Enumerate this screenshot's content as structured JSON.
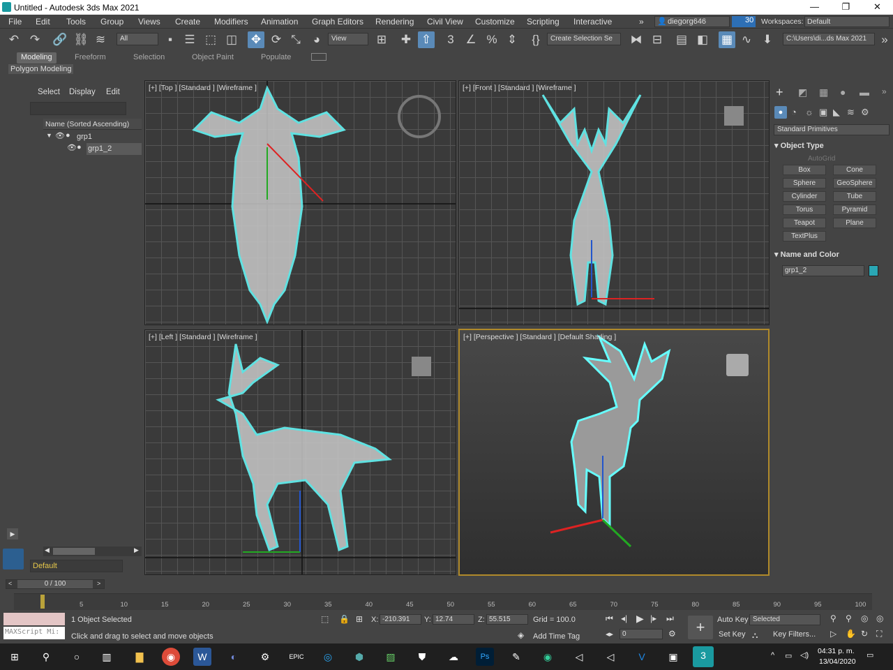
{
  "window": {
    "title": "Untitled - Autodesk 3ds Max 2021",
    "min": "—",
    "max": "❐",
    "close": "✕"
  },
  "menus": [
    "File",
    "Edit",
    "Tools",
    "Group",
    "Views",
    "Create",
    "Modifiers",
    "Animation",
    "Graph Editors",
    "Rendering",
    "Civil View",
    "Customize",
    "Scripting",
    "Interactive"
  ],
  "user": {
    "name": "diegorg646",
    "badge": "30",
    "workspaces_label": "Workspaces:",
    "workspace": "Default"
  },
  "toolbar": {
    "filter": "All",
    "view": "View",
    "selection_set": "Create Selection Se",
    "path": "C:\\Users\\di...ds Max 2021"
  },
  "ribbon": {
    "tabs": [
      "Modeling",
      "Freeform",
      "Selection",
      "Object Paint",
      "Populate"
    ],
    "sub": "Polygon Modeling"
  },
  "scene": {
    "tabs": [
      "Select",
      "Display",
      "Edit"
    ],
    "column": "Name (Sorted Ascending)",
    "items": [
      "grp1",
      "grp1_2"
    ],
    "layer": "Default"
  },
  "viewports": {
    "top": "[+] [Top ] [Standard ] [Wireframe ]",
    "front": "[+] [Front ] [Standard ] [Wireframe ]",
    "left": "[+] [Left ] [Standard ] [Wireframe ]",
    "persp": "[+] [Perspective ] [Standard ] [Default Shading ]"
  },
  "right": {
    "category": "Standard Primitives",
    "object_type": "Object Type",
    "autogrid": "AutoGrid",
    "buttons": [
      "Box",
      "Cone",
      "Sphere",
      "GeoSphere",
      "Cylinder",
      "Tube",
      "Torus",
      "Pyramid",
      "Teapot",
      "Plane",
      "TextPlus"
    ],
    "name_color": "Name and Color",
    "name_value": "grp1_2",
    "swatch": "#2aa7b5"
  },
  "timeline": {
    "frame": "0 / 100",
    "ticks": [
      "5",
      "10",
      "15",
      "20",
      "25",
      "30",
      "35",
      "40",
      "45",
      "50",
      "55",
      "60",
      "65",
      "70",
      "75",
      "80",
      "85",
      "90",
      "95",
      "100"
    ]
  },
  "status": {
    "selected": "1 Object Selected",
    "hint": "Click and drag to select and move objects",
    "maxscript": "MAXScript Mi:",
    "x_label": "X:",
    "x": "-210.391",
    "y_label": "Y:",
    "y": "12.74",
    "z_label": "Z:",
    "z": "55.515",
    "grid": "Grid = 100.0",
    "add_time_tag": "Add Time Tag",
    "auto_key": "Auto Key",
    "selected_dd": "Selected",
    "set_key": "Set Key",
    "key_filters": "Key Filters...",
    "frame_field": "0"
  },
  "taskbar": {
    "time": "04:31 p. m.",
    "date": "13/04/2020"
  }
}
